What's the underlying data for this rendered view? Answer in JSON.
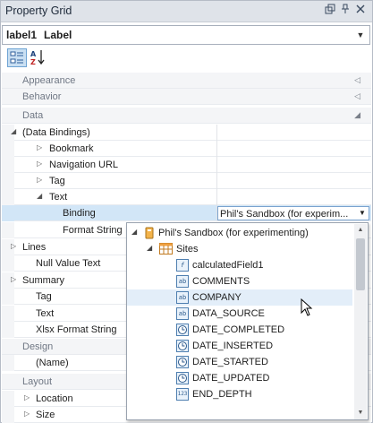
{
  "window": {
    "title": "Property Grid"
  },
  "selector": {
    "object_name": "label1",
    "object_type": "Label"
  },
  "toolbar": {
    "categorized_icon": "categorized-icon",
    "alphabetical_icon": "sort-az-icon"
  },
  "grid": {
    "categories": {
      "appearance": "Appearance",
      "behavior": "Behavior",
      "data": "Data",
      "design": "Design",
      "layout": "Layout"
    },
    "props": {
      "data_bindings": "(Data Bindings)",
      "bookmark": "Bookmark",
      "navigation_url": "Navigation URL",
      "tag": "Tag",
      "text": "Text",
      "binding": "Binding",
      "binding_value": "Phil's Sandbox (for experim...",
      "format_string": "Format String",
      "lines": "Lines",
      "null_value_text": "Null Value Text",
      "summary": "Summary",
      "tag2": "Tag",
      "text2": "Text",
      "xlsx_format_string": "Xlsx Format String",
      "name": "(Name)",
      "location": "Location",
      "size": "Size"
    }
  },
  "popup": {
    "datasource": "Phil's Sandbox (for experimenting)",
    "table": "Sites",
    "fields": [
      {
        "name": "calculatedField1",
        "icon": "f"
      },
      {
        "name": "COMMENTS",
        "icon": "ab"
      },
      {
        "name": "COMPANY",
        "icon": "ab"
      },
      {
        "name": "DATA_SOURCE",
        "icon": "ab"
      },
      {
        "name": "DATE_COMPLETED",
        "icon": "clock"
      },
      {
        "name": "DATE_INSERTED",
        "icon": "clock"
      },
      {
        "name": "DATE_STARTED",
        "icon": "clock"
      },
      {
        "name": "DATE_UPDATED",
        "icon": "clock"
      },
      {
        "name": "END_DEPTH",
        "icon": "123"
      }
    ]
  }
}
